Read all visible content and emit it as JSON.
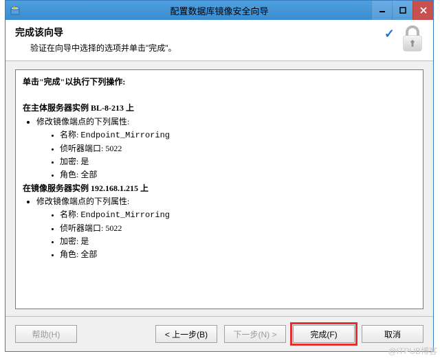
{
  "window": {
    "title": "配置数据库镜像安全向导"
  },
  "header": {
    "title": "完成该向导",
    "subtitle": "验证在向导中选择的选项并单击\"完成\"。"
  },
  "content": {
    "intro": "单击\"完成\"以执行下列操作:",
    "principal_heading": "在主体服务器实例 BL-8-213 上",
    "principal_modify": "修改镜像端点的下列属性:",
    "p_name_label": "名称:",
    "p_name_value": "Endpoint_Mirroring",
    "p_port_label": "侦听器端口:",
    "p_port_value": "5022",
    "p_enc_label": "加密:",
    "p_enc_value": "是",
    "p_role_label": "角色:",
    "p_role_value": "全部",
    "mirror_heading": "在镜像服务器实例 192.168.1.215 上",
    "mirror_modify": "修改镜像端点的下列属性:",
    "m_name_label": "名称:",
    "m_name_value": "Endpoint_Mirroring",
    "m_port_label": "侦听器端口:",
    "m_port_value": "5022",
    "m_enc_label": "加密:",
    "m_enc_value": "是",
    "m_role_label": "角色:",
    "m_role_value": "全部"
  },
  "buttons": {
    "help": "帮助(H)",
    "back": "< 上一步(B)",
    "next": "下一步(N) >",
    "finish": "完成(F)",
    "cancel": "取消"
  },
  "watermark": "@ITPUB博客"
}
